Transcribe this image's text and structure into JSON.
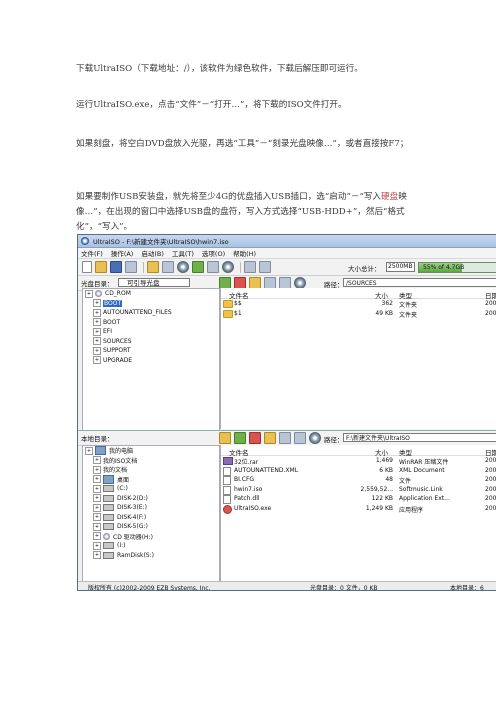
{
  "paragraphs": {
    "p1": "下载UltraISO（下载地址：/），该软件为绿色软件，下载后解压即可运行。",
    "p2": "运行UltraISO.exe，点击“文件”－“打开…”，将下载的ISO文件打开。",
    "p3": "如果刻盘，将空白DVD盘放入光驱，再选“工具”－“刻录光盘映像…”，或者直接按F7；",
    "p4_a": "如果要制作USB安装盘，就先将至少4G的优盘插入USB插口，选“启动”－“写入",
    "p4_hl": "硬盘",
    "p4_b": "映像…”，在出现的窗口中选择USB盘的盘符，写入方式选择“USB-HDD+”，然后“格式化”，“写入”。"
  },
  "window": {
    "title": "UltraISO - F:\\新建文件夹\\UltraISO\\hwin7.iso",
    "menu": [
      "文件(F)",
      "操作(A)",
      "启动(B)",
      "工具(T)",
      "选项(O)",
      "帮助(H)"
    ],
    "size_label": "大小总计：",
    "size_value": "2500MB",
    "size_bar_text": "55% of 4.7GB",
    "size_percent": 55,
    "top_header": {
      "label": "光盘目录：",
      "box": "可引导光盘",
      "path_label": "路径：",
      "path": "/SOURCES"
    },
    "top_tree": [
      {
        "label": "CD_ROM",
        "kind": "disc",
        "indent": 0,
        "selected": false
      },
      {
        "label": "BOOT",
        "kind": "folder",
        "indent": 1,
        "selected": true
      },
      {
        "label": "AUTOUNATTEND_FILES",
        "kind": "folder",
        "indent": 1,
        "selected": false
      },
      {
        "label": "BOOT",
        "kind": "folder",
        "indent": 1,
        "selected": false
      },
      {
        "label": "EFI",
        "kind": "folder",
        "indent": 1,
        "selected": false
      },
      {
        "label": "SOURCES",
        "kind": "folder",
        "indent": 1,
        "selected": false
      },
      {
        "label": "SUPPORT",
        "kind": "folder",
        "indent": 1,
        "selected": false
      },
      {
        "label": "UPGRADE",
        "kind": "folder",
        "indent": 1,
        "selected": false
      }
    ],
    "columns": [
      "文件名",
      "大小",
      "类型",
      "日期"
    ],
    "top_list": [
      {
        "icon": "folder",
        "name": "$$",
        "size": "362",
        "type": "文件夹",
        "date": "200"
      },
      {
        "icon": "folder",
        "name": "$1",
        "size": "49 KB",
        "type": "文件夹",
        "date": "200"
      }
    ],
    "bottom_header": {
      "label": "本地目录：",
      "path_label": "路径：",
      "path": "F:\\新建文件夹\\UltraISO"
    },
    "bottom_tree": [
      {
        "label": "我的电脑",
        "kind": "comp",
        "indent": 0
      },
      {
        "label": "我的ISO文档",
        "kind": "folder",
        "indent": 1
      },
      {
        "label": "我的文档",
        "kind": "folder",
        "indent": 1
      },
      {
        "label": "桌面",
        "kind": "comp",
        "indent": 1
      },
      {
        "label": "(C:)",
        "kind": "drv",
        "indent": 1
      },
      {
        "label": "DISK-2(D:)",
        "kind": "drv",
        "indent": 1
      },
      {
        "label": "DISK-3(E:)",
        "kind": "drv",
        "indent": 1
      },
      {
        "label": "DISK-4(F:)",
        "kind": "drv",
        "indent": 1
      },
      {
        "label": "DISK-5(G:)",
        "kind": "drv",
        "indent": 1
      },
      {
        "label": "CD 驱动器(H:)",
        "kind": "disc",
        "indent": 1
      },
      {
        "label": "(I:)",
        "kind": "drv",
        "indent": 1
      },
      {
        "label": "RamDisk(S:)",
        "kind": "drv",
        "indent": 1
      }
    ],
    "bottom_list": [
      {
        "icon": "rar",
        "name": "32位.rar",
        "size": "1,469",
        "type": "WinRAR 压缩文件",
        "date": "200"
      },
      {
        "icon": "file",
        "name": "AUTOUNATTEND.XML",
        "size": "6 KB",
        "type": "XML Document",
        "date": "200"
      },
      {
        "icon": "file",
        "name": "BI.CFG",
        "size": "48",
        "type": "文件",
        "date": "200"
      },
      {
        "icon": "file",
        "name": "hwin7.iso",
        "size": "2,559,52...",
        "type": "Softmusic.Link",
        "date": "200"
      },
      {
        "icon": "file",
        "name": "Patch.dll",
        "size": "122 KB",
        "type": "Application Ext...",
        "date": "200"
      },
      {
        "icon": "app",
        "name": "UltraISO.exe",
        "size": "1,249 KB",
        "type": "应用程序",
        "date": "200"
      }
    ],
    "status": {
      "copyright": "版权所有 (c)2002-2009 EZB Systems, Inc.",
      "cd_dir": "光盘目录：0 文件，0 KB",
      "local_dir": "本地目录：6"
    }
  }
}
